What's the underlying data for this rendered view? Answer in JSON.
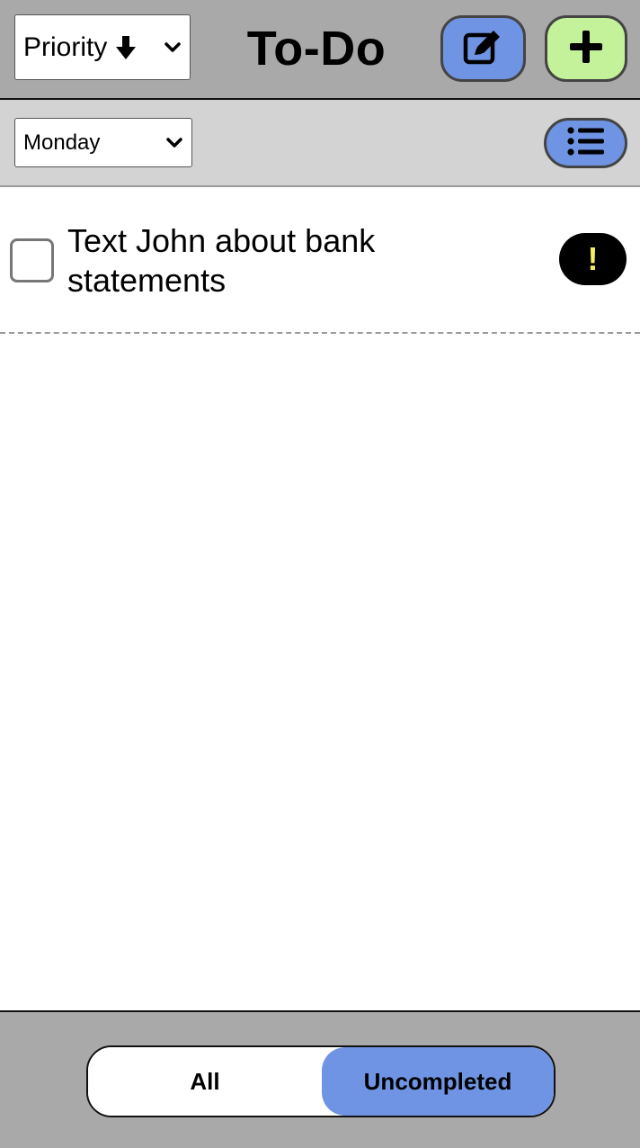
{
  "header": {
    "sort": {
      "selected": "Priority",
      "direction_icon": "arrow-down-icon"
    },
    "title": "To-Do",
    "edit_button_icon": "edit-icon",
    "add_button_icon": "plus-icon"
  },
  "subbar": {
    "day": {
      "selected": "Monday"
    },
    "list_button_icon": "list-icon"
  },
  "tasks": [
    {
      "text": "Text John about bank statements",
      "checked": false,
      "priority_symbol": "!"
    }
  ],
  "filter": {
    "options": [
      "All",
      "Uncompleted"
    ],
    "active": "Uncompleted"
  },
  "colors": {
    "header_bg": "#a9a9a9",
    "subbar_bg": "#d3d3d3",
    "accent_blue": "#6f94e3",
    "accent_green": "#c4f29a",
    "priority_badge": "#000000",
    "priority_mark": "#f2ef62"
  }
}
